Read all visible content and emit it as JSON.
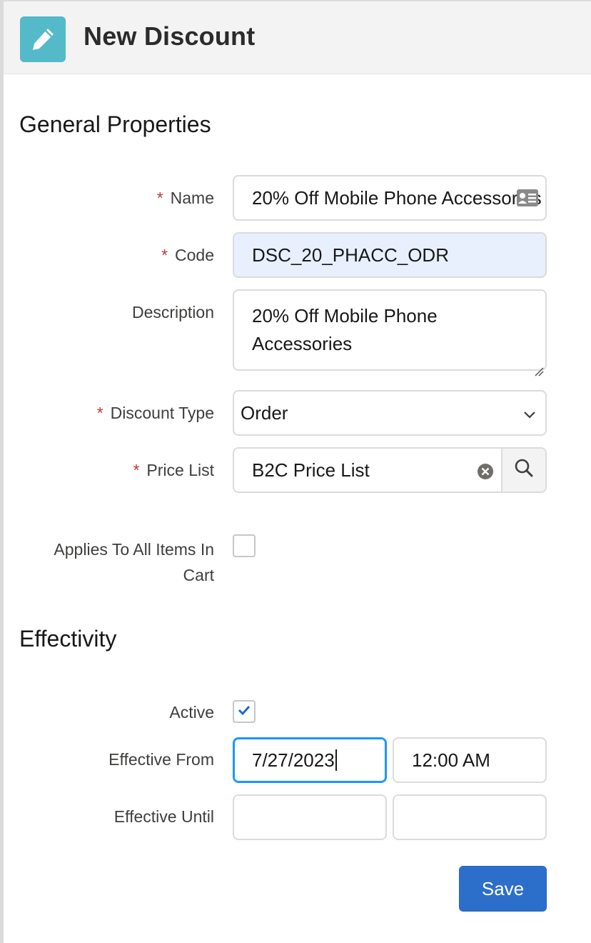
{
  "header": {
    "title": "New Discount",
    "icon": "pencil-icon",
    "icon_color": "#54b9c8"
  },
  "general": {
    "title": "General Properties",
    "name": {
      "label": "Name",
      "required": "*",
      "value": "20% Off Mobile Phone Accessories",
      "icon": "contact-card-icon"
    },
    "code": {
      "label": "Code",
      "required": "*",
      "value": "DSC_20_PHACC_ODR"
    },
    "description": {
      "label": "Description",
      "value_line1": "20% Off Mobile Phone",
      "value_line2": "Accessories"
    },
    "discount_type": {
      "label": "Discount Type",
      "required": "*",
      "value": "Order"
    },
    "price_list": {
      "label": "Price List",
      "required": "*",
      "value": "B2C Price List"
    },
    "applies_all": {
      "label_line1": "Applies To All Items In",
      "label_line2": "Cart",
      "checked": false
    }
  },
  "effectivity": {
    "title": "Effectivity",
    "active": {
      "label": "Active",
      "checked": true
    },
    "effective_from": {
      "label": "Effective From",
      "date": "7/27/2023",
      "time": "12:00 AM"
    },
    "effective_until": {
      "label": "Effective Until",
      "date": "",
      "time": ""
    }
  },
  "actions": {
    "save_label": "Save",
    "save_color": "#2c6fcb"
  }
}
